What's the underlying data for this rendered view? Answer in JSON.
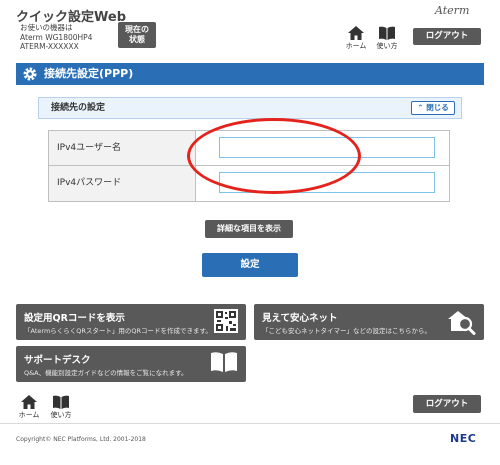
{
  "header": {
    "title": "クイック設定Web",
    "device_lines": [
      "お使いの機器は",
      "Aterm WG1800HP4",
      "ATERM-XXXXXX"
    ],
    "status_button": [
      "現在の",
      "状態"
    ],
    "brand": "Aterm",
    "home_label": "ホーム",
    "guide_label": "使い方",
    "logout_label": "ログアウト"
  },
  "section": {
    "title": "接続先設定(PPP)",
    "subsection_title": "接続先の設定",
    "collapse_label": "閉じる"
  },
  "form": {
    "rows": [
      {
        "label": "IPv4ユーザー名",
        "value": ""
      },
      {
        "label": "IPv4パスワード",
        "value": ""
      }
    ]
  },
  "buttons": {
    "details": "詳細な項目を表示",
    "apply": "設定"
  },
  "tiles": {
    "qr": {
      "title": "設定用QRコードを表示",
      "desc": "「AtermらくらくQRスタート」用のQRコードを作成できます。"
    },
    "safe": {
      "title": "見えて安心ネット",
      "desc": "「こども安心ネットタイマー」などの設定はこちらから。"
    },
    "support": {
      "title": "サポートデスク",
      "desc": "Q&A、機能別設定ガイドなどの情報をご覧になれます。"
    }
  },
  "footer": {
    "home_label": "ホーム",
    "guide_label": "使い方",
    "logout_label": "ログアウト",
    "copyright": "Copyright© NEC Platforms, Ltd. 2001-2018",
    "brand": "NEC"
  },
  "colors": {
    "accent_blue": "#2a6fb6",
    "button_gray": "#595959",
    "annotation_red": "#e3231c"
  }
}
